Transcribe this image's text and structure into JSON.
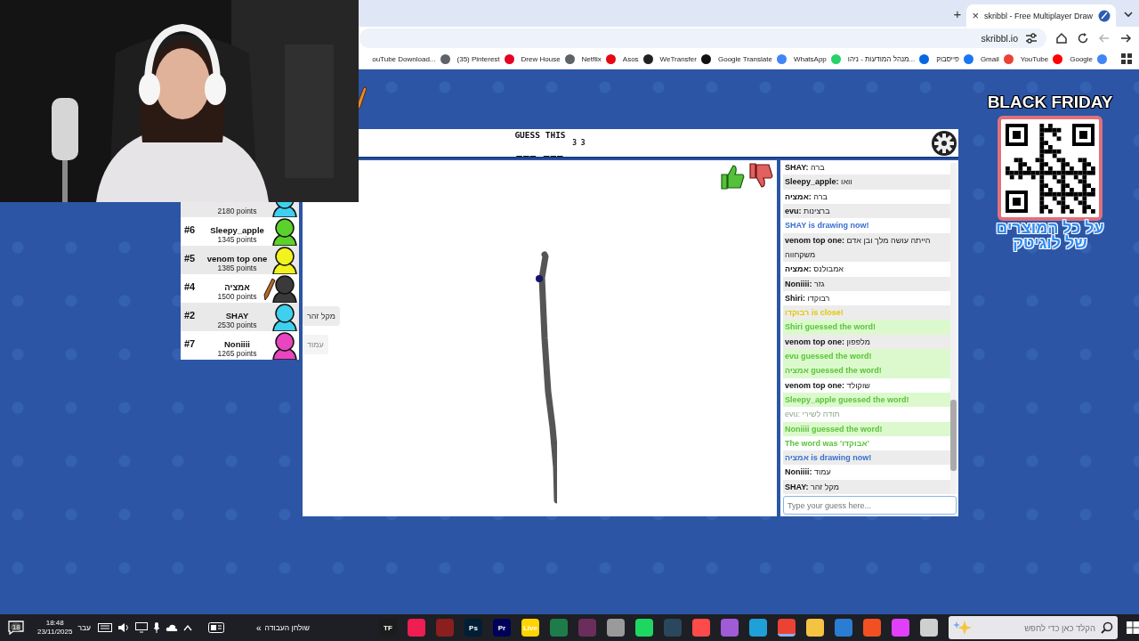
{
  "browser": {
    "new_tab": "+",
    "tabs": [
      {
        "title": "skribbl - Free Multiplayer Draw",
        "close": "×",
        "selected": true
      }
    ],
    "address": "skribbl.io",
    "nav_buttons": [
      {
        "kind": "left",
        "disabled": true
      },
      {
        "kind": "right",
        "disabled": false
      }
    ],
    "bookmarks": [
      {
        "label": "Google",
        "color": "#4285f4"
      },
      {
        "label": "YouTube",
        "color": "#ff0000"
      },
      {
        "label": "Gmail",
        "color": "#ea4335"
      },
      {
        "label": "פייסבוק",
        "color": "#1877f2"
      },
      {
        "label": "מנהל המודעות - ניהו...",
        "color": "#0668e1"
      },
      {
        "label": "WhatsApp",
        "color": "#25d366"
      },
      {
        "label": "Google Translate",
        "color": "#4285f4"
      },
      {
        "label": "WeTransfer",
        "color": "#111111"
      },
      {
        "label": "Asos",
        "color": "#222222"
      },
      {
        "label": "Netflix",
        "color": "#e50914"
      },
      {
        "label": "Drew House",
        "color": "#5f6368"
      },
      {
        "label": "(35) Pinterest",
        "color": "#e60023"
      },
      {
        "label": "ouTube Download...",
        "color": "#5f6368"
      }
    ]
  },
  "game": {
    "header": {
      "title": "GUESS THIS",
      "hint_counts": "3 3",
      "hint": "___ ___"
    },
    "players": [
      {
        "points": "2180 points",
        "color": "#3fd0f0",
        "drawing": false
      },
      {
        "rank": "#6",
        "name": "Sleepy_apple",
        "points": "1345 points",
        "color": "#5bd12b",
        "drawing": false
      },
      {
        "rank": "#5",
        "name": "venom top one",
        "points": "1385 points",
        "color": "#f2f21e",
        "drawing": false
      },
      {
        "rank": "#4",
        "name": "אמציה",
        "points": "1500 points",
        "color": "#3a3a3a",
        "drawing": true
      },
      {
        "rank": "#2",
        "name": "SHAY",
        "points": "2530 points",
        "color": "#3fd0f0",
        "drawing": false,
        "bubble": {
          "text": "מקל זהר",
          "fading": false
        }
      },
      {
        "rank": "#7",
        "name": "Noniiii",
        "points": "1265 points",
        "color": "#e845c0",
        "drawing": false,
        "bubble": {
          "text": "עמוד",
          "fading": true
        }
      }
    ],
    "chat": [
      {
        "kind": "chat",
        "name": "SHAY:",
        "text": "ברה"
      },
      {
        "kind": "chat",
        "name": "Sleepy_apple:",
        "text": "וואו"
      },
      {
        "kind": "chat",
        "name": "אמציה:",
        "text": "ברה"
      },
      {
        "kind": "chat",
        "name": "evu:",
        "text": "ברצינות"
      },
      {
        "kind": "drawing",
        "text": "SHAY is drawing now!"
      },
      {
        "kind": "chat",
        "name": "venom top one:",
        "text": "הייתה עושה מלך ובן אדם משקחווה"
      },
      {
        "kind": "chat",
        "name": "אמציה:",
        "text": "אמבולנס"
      },
      {
        "kind": "chat",
        "name": "Noniiii:",
        "text": "גזר"
      },
      {
        "kind": "chat",
        "name": "Shiri:",
        "text": "רבוקדו"
      },
      {
        "kind": "close",
        "text": "רבוקדו is close!"
      },
      {
        "kind": "guessed",
        "text": "Shiri guessed the word!"
      },
      {
        "kind": "chat",
        "name": "venom top one:",
        "text": "מלפפון"
      },
      {
        "kind": "guessed",
        "text": "evu guessed the word!"
      },
      {
        "kind": "guessed",
        "text": "אמציה guessed the word!"
      },
      {
        "kind": "chat",
        "name": "venom top one:",
        "text": "שוקולד"
      },
      {
        "kind": "guessed",
        "text": "Sleepy_apple guessed the word!"
      },
      {
        "kind": "guesser",
        "name": "evu:",
        "text": "תודה לשירי"
      },
      {
        "kind": "guessed",
        "text": "Noniiii guessed the word!"
      },
      {
        "kind": "reveal",
        "text": "The word was 'אבוקדו'"
      },
      {
        "kind": "drawing",
        "text": "אמציה is drawing now!"
      },
      {
        "kind": "chat",
        "name": "Noniiii:",
        "text": "עמוד"
      },
      {
        "kind": "chat",
        "name": "SHAY:",
        "text": "מקל זהר"
      }
    ],
    "guess_input": {
      "placeholder": "Type your guess here..."
    }
  },
  "promo": {
    "title": "BLACK FRIDAY",
    "caption_lines": [
      "על כל המוצרים",
      "של לוגיטק"
    ]
  },
  "taskbar": {
    "notifications": "18",
    "time": "18:48",
    "date": "23/11/2025",
    "language": "עבר",
    "desktop_chevron": "«",
    "desktop_label": "שולחן העבודה",
    "apps": [
      {
        "color": "#cfcfcf",
        "selected": false
      },
      {
        "color": "#e040fb",
        "selected": false
      },
      {
        "color": "#f25022",
        "selected": false
      },
      {
        "color": "#2b7cd3",
        "selected": false
      },
      {
        "color": "#f5c342",
        "selected": false
      },
      {
        "color": "#ea4335",
        "selected": true
      },
      {
        "color": "#1fa0d8",
        "selected": false
      },
      {
        "color": "#a05bd6",
        "selected": false
      },
      {
        "color": "#ff4a4a",
        "selected": false
      },
      {
        "color": "#2a475e",
        "selected": false
      },
      {
        "color": "#1ed760",
        "selected": false
      },
      {
        "color": "#9a9a9a",
        "selected": false
      },
      {
        "color": "#6b2d5c",
        "selected": false
      },
      {
        "color": "#1e7c4a",
        "selected": false
      },
      {
        "label": "Live",
        "color": "#ffd400",
        "selected": false
      },
      {
        "label": "Pr",
        "color": "#00005b",
        "selected": false
      },
      {
        "label": "Ps",
        "color": "#001e36",
        "selected": false
      },
      {
        "color": "#8b1e1e",
        "selected": false
      },
      {
        "color": "#ee1d52",
        "selected": false
      },
      {
        "label": "TF",
        "color": "#1c1c1c",
        "selected": false
      }
    ],
    "search_placeholder": "הקלד כאן כדי לחפש"
  }
}
